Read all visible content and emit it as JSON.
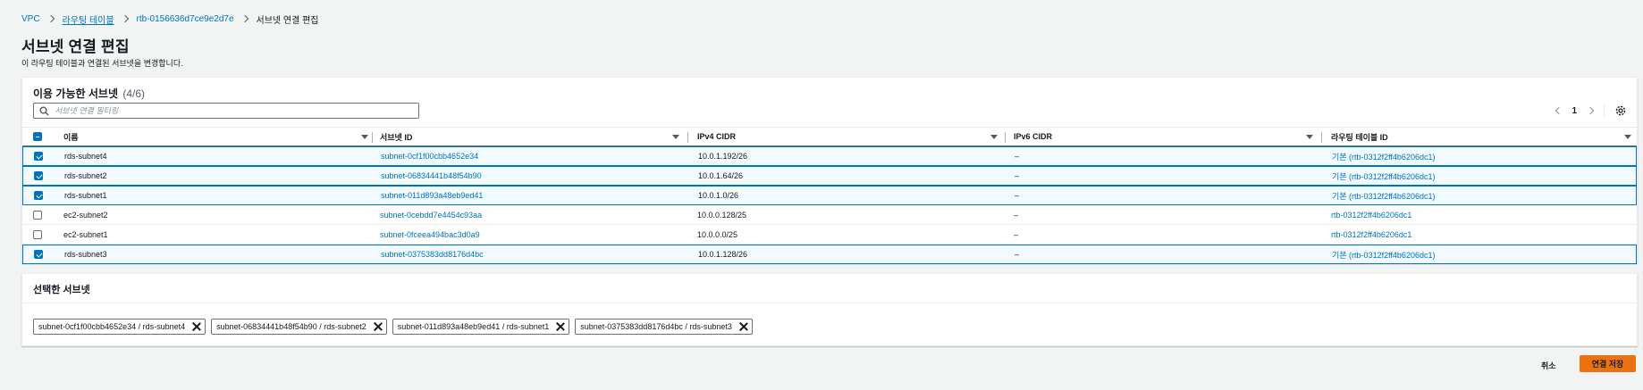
{
  "breadcrumb": {
    "items": [
      {
        "label": "VPC"
      },
      {
        "label": "라우팅 테이블"
      },
      {
        "label": "rtb-0156636d7ce9e2d7e"
      }
    ],
    "current": "서브넷 연결 편집"
  },
  "page": {
    "title": "서브넷 연결 편집",
    "description": "이 라우팅 테이블과 연결된 서브넷을 변경합니다."
  },
  "available": {
    "title": "이용 가능한 서브넷",
    "count": "(4/6)",
    "search_placeholder": "서브넷 연결 필터링",
    "page_number": "1",
    "columns": {
      "name": "이름",
      "subnet_id": "서브넷 ID",
      "ipv4": "IPv4 CIDR",
      "ipv6": "IPv6 CIDR",
      "route_table": "라우팅 테이블 ID"
    },
    "rows": [
      {
        "checked": true,
        "name": "rds-subnet4",
        "subnet_id": "subnet-0cf1f00cbb4652e34",
        "ipv4": "10.0.1.192/26",
        "ipv6": "–",
        "route_table": "기본 (rtb-0312f2ff4b6206dc1)"
      },
      {
        "checked": true,
        "name": "rds-subnet2",
        "subnet_id": "subnet-06834441b48f54b90",
        "ipv4": "10.0.1.64/26",
        "ipv6": "–",
        "route_table": "기본 (rtb-0312f2ff4b6206dc1)"
      },
      {
        "checked": true,
        "name": "rds-subnet1",
        "subnet_id": "subnet-011d893a48eb9ed41",
        "ipv4": "10.0.1.0/26",
        "ipv6": "–",
        "route_table": "기본 (rtb-0312f2ff4b6206dc1)"
      },
      {
        "checked": false,
        "name": "ec2-subnet2",
        "subnet_id": "subnet-0cebdd7e4454c93aa",
        "ipv4": "10.0.0.128/25",
        "ipv6": "–",
        "route_table": "rtb-0312f2ff4b6206dc1"
      },
      {
        "checked": false,
        "name": "ec2-subnet1",
        "subnet_id": "subnet-0fceea494bac3d0a9",
        "ipv4": "10.0.0.0/25",
        "ipv6": "–",
        "route_table": "rtb-0312f2ff4b6206dc1"
      },
      {
        "checked": true,
        "name": "rds-subnet3",
        "subnet_id": "subnet-0375383dd8176d4bc",
        "ipv4": "10.0.1.128/26",
        "ipv6": "–",
        "route_table": "기본 (rtb-0312f2ff4b6206dc1)"
      }
    ]
  },
  "selected": {
    "title": "선택한 서브넷",
    "tokens": [
      {
        "label": "subnet-0cf1f00cbb4652e34 / rds-subnet4"
      },
      {
        "label": "subnet-06834441b48f54b90 / rds-subnet2"
      },
      {
        "label": "subnet-011d893a48eb9ed41 / rds-subnet1"
      },
      {
        "label": "subnet-0375383dd8176d4bc / rds-subnet3"
      }
    ]
  },
  "actions": {
    "cancel": "취소",
    "save": "연결 저장"
  },
  "colors": {
    "link": "#0073bb",
    "selected_row_bg": "#f1faff",
    "primary_button": "#ec7211"
  }
}
